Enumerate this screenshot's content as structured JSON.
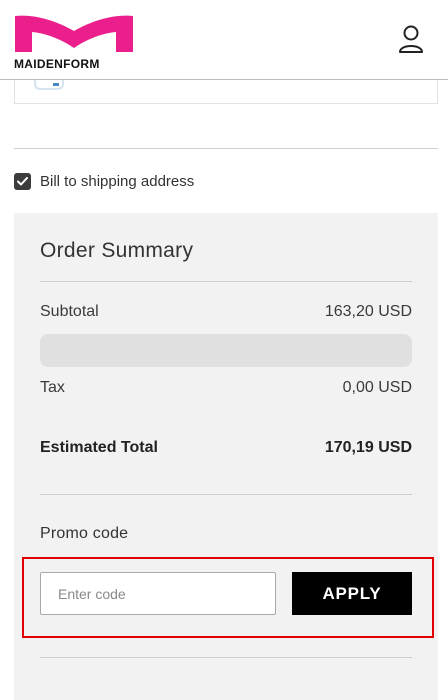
{
  "header": {
    "brand": "MAIDENFORM",
    "brand_color": "#ea1f8c",
    "account_icon": "person-icon"
  },
  "payment_card": {
    "icon": "card-brand-icon"
  },
  "billing": {
    "checkbox_checked": true,
    "label": "Bill to shipping address"
  },
  "summary": {
    "title": "Order Summary",
    "subtotal_label": "Subtotal",
    "subtotal_value": "163,20 USD",
    "tax_label": "Tax",
    "tax_value": "0,00 USD",
    "total_label": "Estimated Total",
    "total_value": "170,19 USD"
  },
  "promo": {
    "label": "Promo code",
    "placeholder": "Enter code",
    "value": "",
    "apply_label": "APPLY"
  },
  "colors": {
    "highlight": "#e30000",
    "summary_bg": "#f2f2f2",
    "button_bg": "#000000"
  }
}
